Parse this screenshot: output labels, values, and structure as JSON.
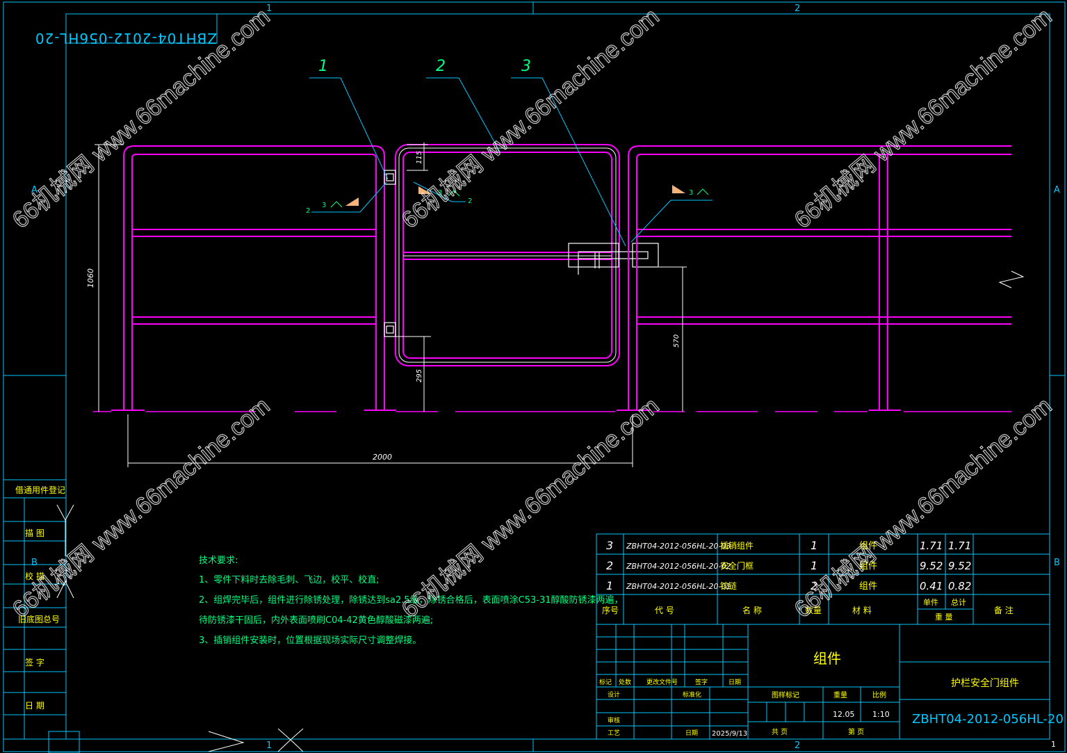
{
  "drawing": {
    "code_mirrored": "ZBHT04-2012-056HL-20",
    "zone_top": [
      "1",
      "2"
    ],
    "zone_bottom": [
      "1",
      "2"
    ],
    "zone_left": [
      "A",
      "B"
    ],
    "zone_right": [
      "A",
      "B"
    ],
    "corner_mark": "1",
    "callouts": [
      "1",
      "2",
      "3"
    ],
    "weld_labels": {
      "left": [
        "2",
        "3"
      ],
      "middle": [
        "3",
        "2"
      ],
      "right": [
        "3"
      ]
    },
    "dimensions": {
      "total_height": "1060",
      "top_gap": "115",
      "bottom_gap": "295",
      "latch_height": "570",
      "overall_width": "2000"
    }
  },
  "side_panel": [
    "借通用件登记",
    "描 图",
    "校 描",
    "旧底图总号",
    "签 字",
    "日 期"
  ],
  "tech_requirements": {
    "title": "技术要求:",
    "lines": [
      "1、零件下料时去除毛刺、飞边，校平、校直;",
      "2、组焊完毕后，组件进行除锈处理，除锈达到sa2.5级，除锈合格后，表面喷涂C53-31醇酸防锈漆两遍，",
      "待防锈漆干固后，内外表面喷刷C04-42黄色醇酸磁漆两遍;",
      "3、插销组件安装时，位置根据现场实际尺寸调整焊接。"
    ]
  },
  "bom": {
    "rows": [
      {
        "no": "3",
        "code": "ZBHT04-2012-056HL-20-03",
        "name": "插销组件",
        "qty": "1",
        "material": "组件",
        "unit": "1.71",
        "total": "1.71"
      },
      {
        "no": "2",
        "code": "ZBHT04-2012-056HL-20-02",
        "name": "安全门框",
        "qty": "1",
        "material": "组件",
        "unit": "9.52",
        "total": "9.52"
      },
      {
        "no": "1",
        "code": "ZBHT04-2012-056HL-20-01",
        "name": "铰链",
        "qty": "2",
        "material": "组件",
        "unit": "0.41",
        "total": "0.82"
      }
    ],
    "header": {
      "no": "序号",
      "code": "代 号",
      "name": "名 称",
      "qty": "数量",
      "material": "材 料",
      "unit": "单件",
      "total": "总计",
      "weight": "重 量",
      "remark": "备 注"
    }
  },
  "title_block": {
    "material": "组件",
    "part_name": "护栏安全门组件",
    "drawing_no": "ZBHT04-2012-056HL-20",
    "rev_headers": [
      "标记",
      "处数",
      "更改文件号",
      "签字",
      "日期"
    ],
    "roles": [
      "设计",
      "审核",
      "工艺"
    ],
    "roles2": [
      "标准化",
      "日期"
    ],
    "date": "2025/9/13",
    "stage_label": "图样标记",
    "weight_label": "重量",
    "scale_label": "比例",
    "weight": "12.05",
    "scale": "1:10",
    "sheets_label": "共 页",
    "sheet_label": "第 页"
  },
  "watermark": {
    "text": "66机械网 www.66machine.com"
  }
}
